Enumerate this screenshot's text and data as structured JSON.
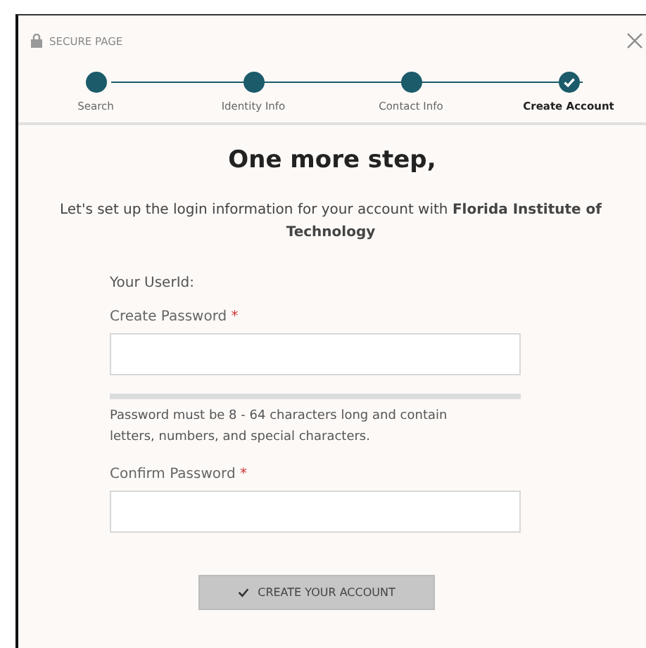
{
  "header": {
    "label": "SECURE PAGE"
  },
  "steps": [
    {
      "label": "Search",
      "selected": false
    },
    {
      "label": "Identity Info",
      "selected": false
    },
    {
      "label": "Contact Info",
      "selected": false
    },
    {
      "label": "Create Account",
      "selected": true
    }
  ],
  "heading": "One more step,",
  "intro": "Let's set up the login information for your account with **Florida Institute of Technology**",
  "userid_label": "Your UserId:",
  "fields": [
    {
      "label": "Create Password",
      "required_mark": "*",
      "hint": "Password must be 8 - 64 characters long and contain letters, numbers, and special characters."
    },
    {
      "label": "Confirm Password",
      "required_mark": "*"
    }
  ],
  "button": {
    "label": "CREATE YOUR ACCOUNT"
  }
}
